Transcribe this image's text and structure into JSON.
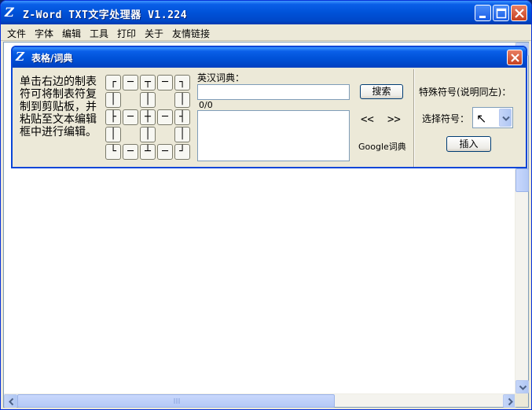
{
  "window": {
    "icon": "Z",
    "title": "Z-Word TXT文字处理器 V1.224"
  },
  "menu": [
    "文件",
    "字体",
    "编辑",
    "工具",
    "打印",
    "关于",
    "友情链接"
  ],
  "dialog": {
    "icon": "Z",
    "title": "表格/词典",
    "description": "单击右边的制表符可将制表符复制到剪贴板，并粘贴至文本编辑框中进行编辑。",
    "box_chars": [
      [
        "┌",
        "─",
        "┬",
        "─",
        "┐"
      ],
      [
        "│",
        "",
        "│",
        "",
        "│"
      ],
      [
        "├",
        "─",
        "┼",
        "─",
        "┤"
      ],
      [
        "│",
        "",
        "│",
        "",
        "│"
      ],
      [
        "└",
        "─",
        "┴",
        "─",
        "┘"
      ]
    ],
    "dict": {
      "label": "英汉词典：",
      "input_value": "",
      "counter": "0/0",
      "result": "",
      "search_label": "搜索",
      "prev_label": "<<",
      "next_label": ">>",
      "google_label": "Google词典"
    },
    "special": {
      "label": "特殊符号(说明同左)：",
      "select_label": "选择符号：",
      "select_value": "↖",
      "insert_label": "插入"
    }
  }
}
